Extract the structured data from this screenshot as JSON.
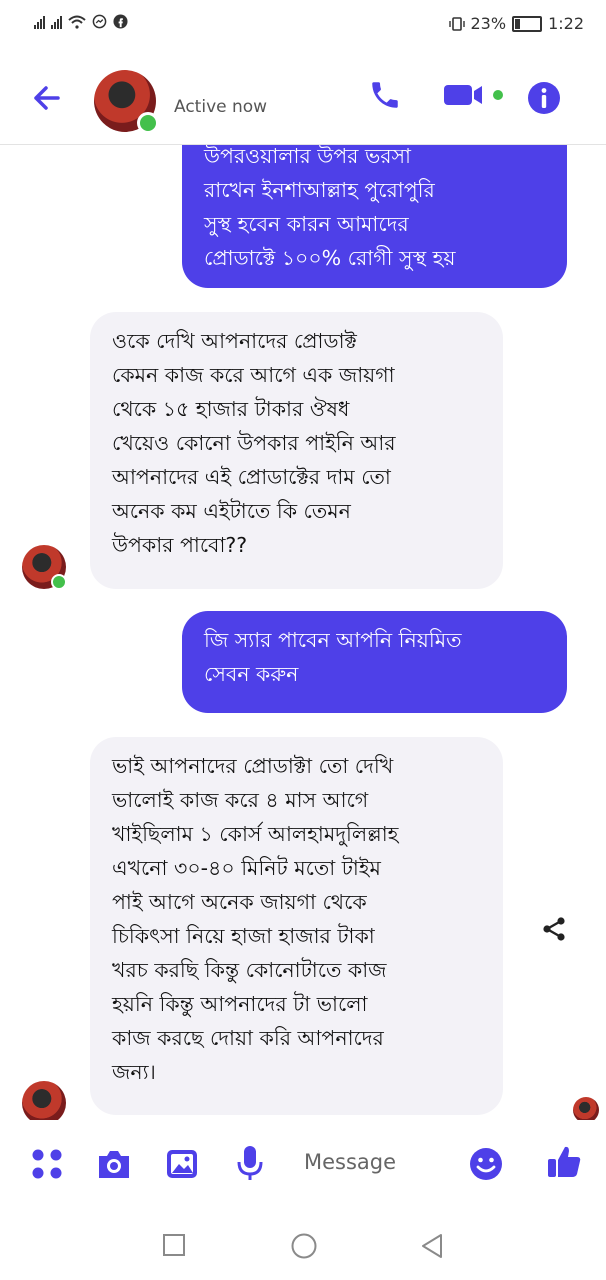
{
  "status_bar": {
    "battery": "23%",
    "time": "1:22",
    "battery_level": 0.23
  },
  "header": {
    "status": "Active now",
    "back_icon": "arrow-left-icon",
    "call_icon": "phone-icon",
    "video_icon": "video-camera-icon",
    "info_icon": "info-icon"
  },
  "messages": [
    {
      "direction": "outgoing",
      "text": "উপরওয়ালার উপর ভরসা\nরাখেন ইনশাআল্লাহ পুরোপুরি\nসুস্থ হবেন কারন আমাদের\nপ্রোডাক্টে ১০০% রোগী সুস্থ হয়"
    },
    {
      "direction": "incoming",
      "text": "ওকে দেখি আপনাদের প্রোডাক্ট\nকেমন কাজ করে আগে এক জায়গা\nথেকে ১৫ হাজার টাকার ঔষধ\nখেয়েও কোনো উপকার পাইনি আর\nআপনাদের এই প্রোডাক্টের দাম তো\nঅনেক কম এইটাতে কি তেমন\nউপকার পাবো??"
    },
    {
      "direction": "outgoing",
      "text": "জি স্যার পাবেন আপনি নিয়মিত\nসেবন করুন"
    },
    {
      "direction": "incoming",
      "text": "ভাই আপনাদের প্রোডাক্টা তো দেখি\nভালোই কাজ করে ৪ মাস আগে\nখাইছিলাম ১ কোর্স আলহামদুলিল্লাহ\nএখনো ৩০-৪০ মিনিট মতো টাইম\nপাই আগে অনেক জায়গা থেকে\nচিকিৎসা নিয়ে হাজা হাজার টাকা\nখরচ করছি কিন্তু কোনোটাতে কাজ\nহয়নি কিন্তু আপনাদের টা ভালো\nকাজ করছে দোয়া করি আপনাদের\nজন্য।"
    }
  ],
  "composer": {
    "placeholder": "Message",
    "icons": [
      "menu-dots-icon",
      "camera-icon",
      "gallery-icon",
      "microphone-icon",
      "emoji-icon",
      "thumbs-up-icon"
    ]
  },
  "share_icon": "share-icon",
  "nav": {
    "icons": [
      "recent-apps-icon",
      "home-icon",
      "back-triangle-icon"
    ]
  },
  "colors": {
    "accent": "#4e40e8",
    "outgoing_bubble": "#4e40e8",
    "incoming_bubble": "#f3f2f7",
    "online": "#43c04b"
  }
}
